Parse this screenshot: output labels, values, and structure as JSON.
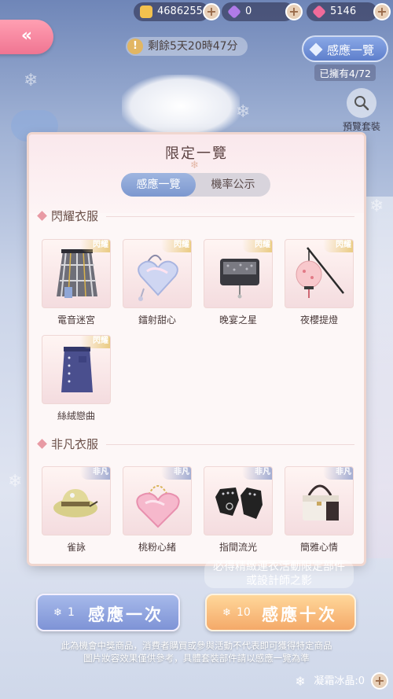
{
  "currencies": [
    {
      "value": "4686255",
      "icon": "gold-cat-coin-icon",
      "color": "#f2c14e"
    },
    {
      "value": "0",
      "icon": "purple-diamond-icon",
      "color": "#b07be8"
    },
    {
      "value": "5146",
      "icon": "pink-diamond-icon",
      "color": "#f06b9a"
    }
  ],
  "header": {
    "back_icon": "double-chevron-left-icon",
    "timer": "剩餘5天20時47分",
    "sense_button": "感應一覽",
    "owned": "已擁有4/72",
    "preview_label": "預覽套裝"
  },
  "modal": {
    "title": "限定一覽",
    "tabs": [
      {
        "label": "感應一覽",
        "active": true
      },
      {
        "label": "機率公示",
        "active": false
      }
    ],
    "sections": [
      {
        "title": "閃耀衣服",
        "badge": "閃耀",
        "items": [
          {
            "name": "電音迷宮",
            "icon": "plaid-skirt-icon"
          },
          {
            "name": "鐳射甜心",
            "icon": "heart-bag-icon"
          },
          {
            "name": "晚宴之星",
            "icon": "black-clutch-icon"
          },
          {
            "name": "夜櫻提燈",
            "icon": "lantern-icon"
          },
          {
            "name": "絲絨戀曲",
            "icon": "denim-skirt-icon"
          }
        ]
      },
      {
        "title": "非凡衣服",
        "badge": "非凡",
        "items": [
          {
            "name": "雀詠",
            "icon": "bird-hat-icon"
          },
          {
            "name": "桃粉心緒",
            "icon": "pink-heart-bag-icon"
          },
          {
            "name": "指間流光",
            "icon": "gloves-icon"
          },
          {
            "name": "簡雅心情",
            "icon": "handbag-icon"
          }
        ]
      }
    ]
  },
  "background_text": {
    "info_line1": "必得精緻連衣活動限定部件",
    "info_line2": "或設計師之影"
  },
  "buttons": {
    "single": {
      "count": "1",
      "label": "感應一次"
    },
    "ten": {
      "count": "10",
      "label": "感應十次"
    }
  },
  "disclaimer": {
    "line1": "此為機會中獎商品，消費者購買或參與活動不代表即可獲得特定商品",
    "line2": "圖片妝容效果僅供參考，具體套裝部件請以感應一覽為準"
  },
  "frost": {
    "label": "凝霜冰晶:0"
  }
}
